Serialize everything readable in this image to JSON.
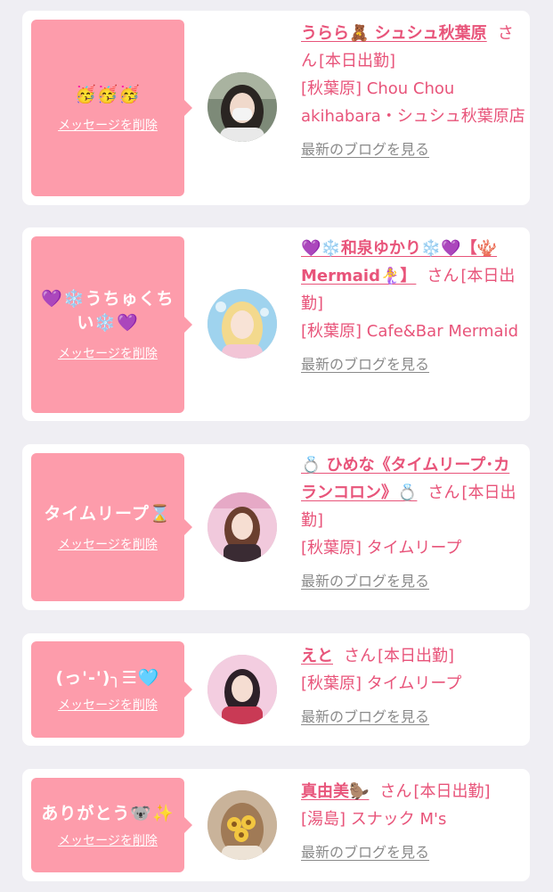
{
  "delete_label": "メッセージを削除",
  "honorific": "さん",
  "blog_label": "最新のブログを見る",
  "colors": {
    "background": "#efeef3",
    "card": "#ffffff",
    "bubble": "#fd9cab",
    "accent_text": "#e8547a",
    "link_gray": "#8a8a8a"
  },
  "items": [
    {
      "message": "🥳🥳🥳",
      "name": "うらら🧸 シュシュ秋葉原",
      "status": "[本日出勤]",
      "shop": "[秋葉原] Chou Chou akihabara・シュシュ秋葉原店"
    },
    {
      "message": "💜❄️うちゅくちい❄️💜",
      "name": "💜❄️和泉ゆかり❄️💜【🪸Mermaid🧜‍♀️】",
      "status": "[本日出勤]",
      "shop": "[秋葉原] Cafe&Bar Mermaid"
    },
    {
      "message": "タイムリープ⌛",
      "name": "💍 ひめな《タイムリープ･カランコロン》💍",
      "status": "[本日出勤]",
      "shop": "[秋葉原] タイムリープ"
    },
    {
      "message": "(っ'-')╮☰🩵",
      "name": "えと",
      "status": "[本日出勤]",
      "shop": "[秋葉原] タイムリープ"
    },
    {
      "message": "ありがとう🐨✨",
      "name": "真由美🦫",
      "status": "[本日出勤]",
      "shop": "[湯島] スナック M's"
    }
  ]
}
